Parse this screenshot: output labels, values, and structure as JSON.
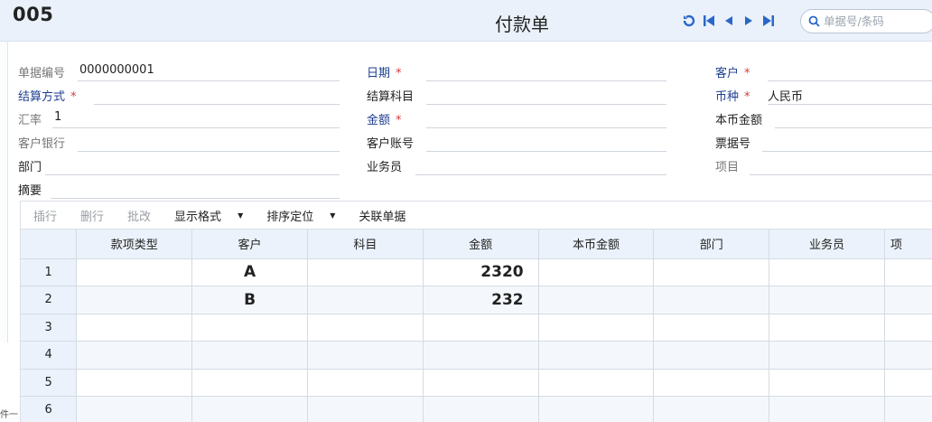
{
  "header": {
    "doc_code": "005",
    "title": "付款单",
    "search_placeholder": "单据号/条码"
  },
  "form": {
    "doc_no": {
      "label": "单据编号",
      "value": "0000000001"
    },
    "date": {
      "label": "日期",
      "required": "*"
    },
    "customer": {
      "label": "客户",
      "required": "*"
    },
    "settle_method": {
      "label": "结算方式",
      "required": "*"
    },
    "settle_account": {
      "label": "结算科目"
    },
    "currency": {
      "label": "币种",
      "required": "*",
      "value": "人民币"
    },
    "rate": {
      "label": "汇率",
      "value": "1"
    },
    "amount": {
      "label": "金额",
      "required": "*"
    },
    "local_amount": {
      "label": "本币金额"
    },
    "customer_bank": {
      "label": "客户银行"
    },
    "customer_account": {
      "label": "客户账号"
    },
    "bill_no": {
      "label": "票据号"
    },
    "department": {
      "label": "部门"
    },
    "salesman": {
      "label": "业务员"
    },
    "project": {
      "label": "项目"
    },
    "summary": {
      "label": "摘要"
    }
  },
  "toolbar": {
    "insert_row": "插行",
    "delete_row": "删行",
    "batch_edit": "批改",
    "display_format": "显示格式",
    "sort_locate": "排序定位",
    "related_docs": "关联单据"
  },
  "table": {
    "columns": [
      "款项类型",
      "客户",
      "科目",
      "金额",
      "本币金额",
      "部门",
      "业务员",
      "项"
    ],
    "rows": [
      {
        "num": "1",
        "cells": [
          "",
          "A",
          "",
          "2320",
          "",
          "",
          "",
          ""
        ]
      },
      {
        "num": "2",
        "cells": [
          "",
          "B",
          "",
          "232",
          "",
          "",
          "",
          ""
        ]
      },
      {
        "num": "3",
        "cells": [
          "",
          "",
          "",
          "",
          "",
          "",
          "",
          ""
        ]
      },
      {
        "num": "4",
        "cells": [
          "",
          "",
          "",
          "",
          "",
          "",
          "",
          ""
        ]
      },
      {
        "num": "5",
        "cells": [
          "",
          "",
          "",
          "",
          "",
          "",
          "",
          ""
        ]
      },
      {
        "num": "6",
        "cells": [
          "",
          "",
          "",
          "",
          "",
          "",
          "",
          ""
        ]
      }
    ]
  },
  "edge_text": "件一"
}
